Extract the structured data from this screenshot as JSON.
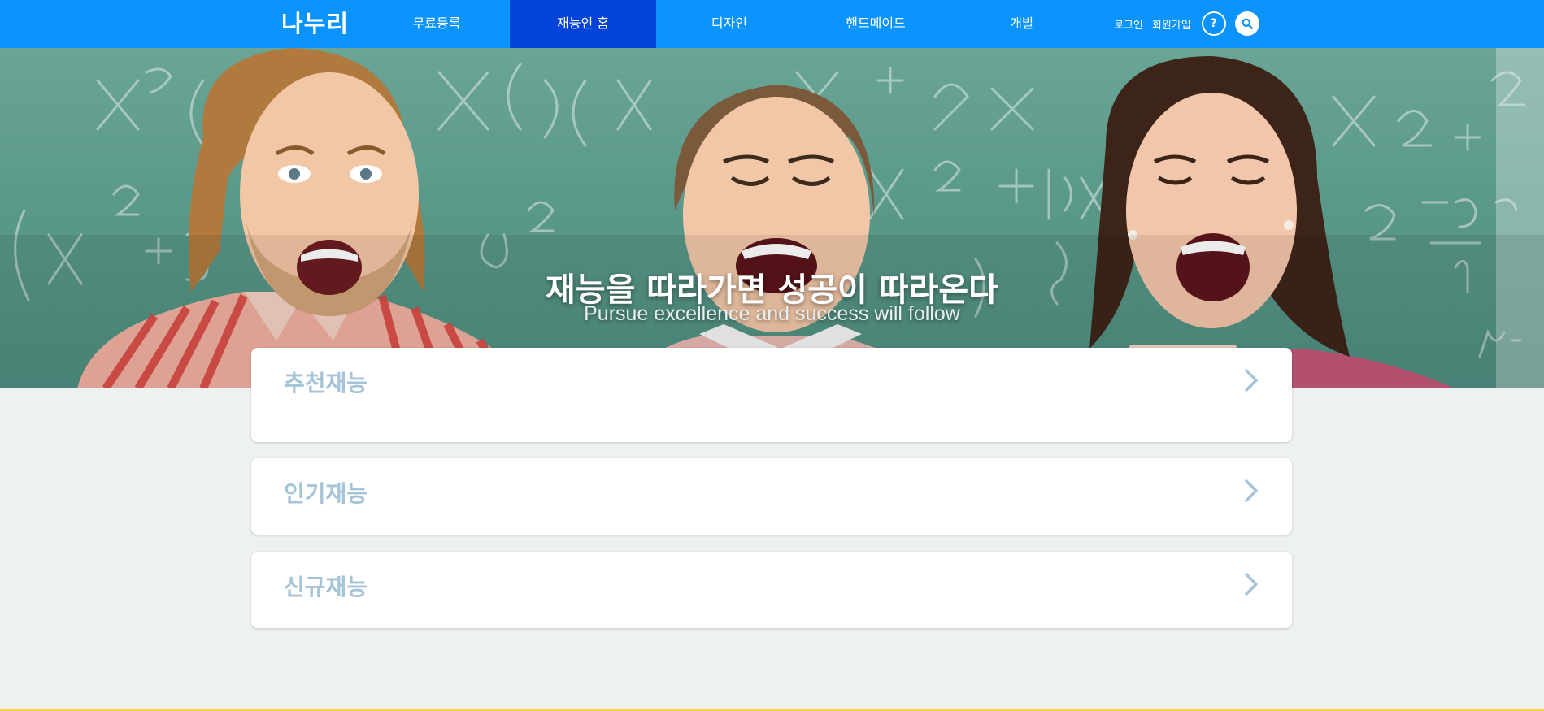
{
  "header": {
    "logo": "나누리",
    "nav": [
      {
        "label": "무료등록",
        "active": false
      },
      {
        "label": "재능인 홈",
        "active": true
      },
      {
        "label": "디자인",
        "active": false
      },
      {
        "label": "핸드메이드",
        "active": false
      },
      {
        "label": "개발",
        "active": false
      }
    ],
    "login": "로그인",
    "signup": "회원가입",
    "help_symbol": "?",
    "help_icon": "question-icon",
    "search_icon": "search-icon"
  },
  "hero": {
    "title": "재능을 따라가면 성공이 따라온다",
    "subtitle": "Pursue excellence and success will follow"
  },
  "sections": [
    {
      "title": "추천재능",
      "icon": "chevron-right-icon"
    },
    {
      "title": "인기재능",
      "icon": "chevron-right-icon"
    },
    {
      "title": "신규재능",
      "icon": "chevron-right-icon"
    }
  ],
  "colors": {
    "header_bg": "#0a93fb",
    "nav_active_bg": "#0443d7",
    "page_bg": "#eef1f2",
    "card_title": "#a5c4d8",
    "bottom_accent": "#f4d54a"
  }
}
